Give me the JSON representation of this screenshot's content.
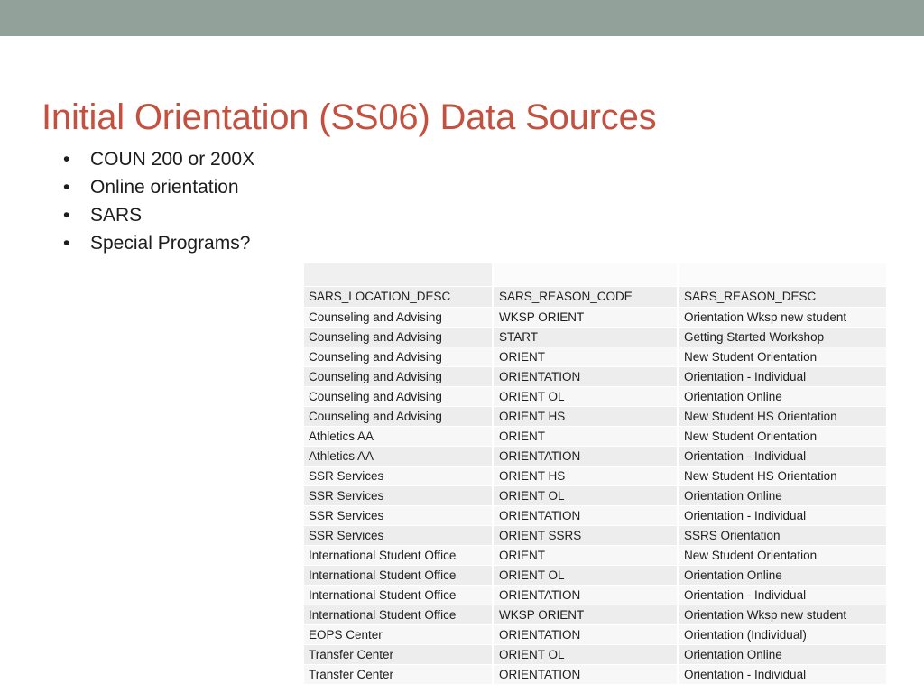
{
  "slide": {
    "title": "Initial Orientation (SS06) Data Sources",
    "title_color": "#c4513f",
    "band_color": "#92a19a",
    "bullet_glyph": "•"
  },
  "bullets": [
    {
      "text": "COUN 200 or 200X"
    },
    {
      "text": "Online orientation"
    },
    {
      "text": "SARS"
    },
    {
      "text": "Special Programs?"
    }
  ],
  "table": {
    "headers": [
      "SARS_LOCATION_DESC",
      "SARS_REASON_CODE",
      "SARS_REASON_DESC"
    ],
    "rows": [
      [
        "Counseling and Advising",
        "WKSP ORIENT",
        "Orientation Wksp new student"
      ],
      [
        "Counseling and Advising",
        "START",
        "Getting Started Workshop"
      ],
      [
        "Counseling and Advising",
        "ORIENT",
        "New Student Orientation"
      ],
      [
        "Counseling and Advising",
        "ORIENTATION",
        "Orientation - Individual"
      ],
      [
        "Counseling and Advising",
        "ORIENT OL",
        "Orientation Online"
      ],
      [
        "Counseling and Advising",
        "ORIENT HS",
        "New Student HS Orientation"
      ],
      [
        "Athletics AA",
        "ORIENT",
        "New Student Orientation"
      ],
      [
        "Athletics AA",
        "ORIENTATION",
        "Orientation - Individual"
      ],
      [
        "SSR Services",
        "ORIENT HS",
        "New Student HS Orientation"
      ],
      [
        "SSR Services",
        "ORIENT OL",
        "Orientation Online"
      ],
      [
        "SSR Services",
        "ORIENTATION",
        "Orientation - Individual"
      ],
      [
        "SSR Services",
        "ORIENT SSRS",
        "SSRS Orientation"
      ],
      [
        "International Student Office",
        "ORIENT",
        "New Student Orientation"
      ],
      [
        "International Student Office",
        "ORIENT OL",
        "Orientation Online"
      ],
      [
        "International Student Office",
        "ORIENTATION",
        "Orientation - Individual"
      ],
      [
        "International Student Office",
        "WKSP ORIENT",
        "Orientation Wksp new student"
      ],
      [
        "EOPS Center",
        "ORIENTATION",
        "Orientation (Individual)"
      ],
      [
        "Transfer Center",
        "ORIENT OL",
        "Orientation Online"
      ],
      [
        "Transfer Center",
        "ORIENTATION",
        "Orientation - Individual"
      ]
    ]
  }
}
